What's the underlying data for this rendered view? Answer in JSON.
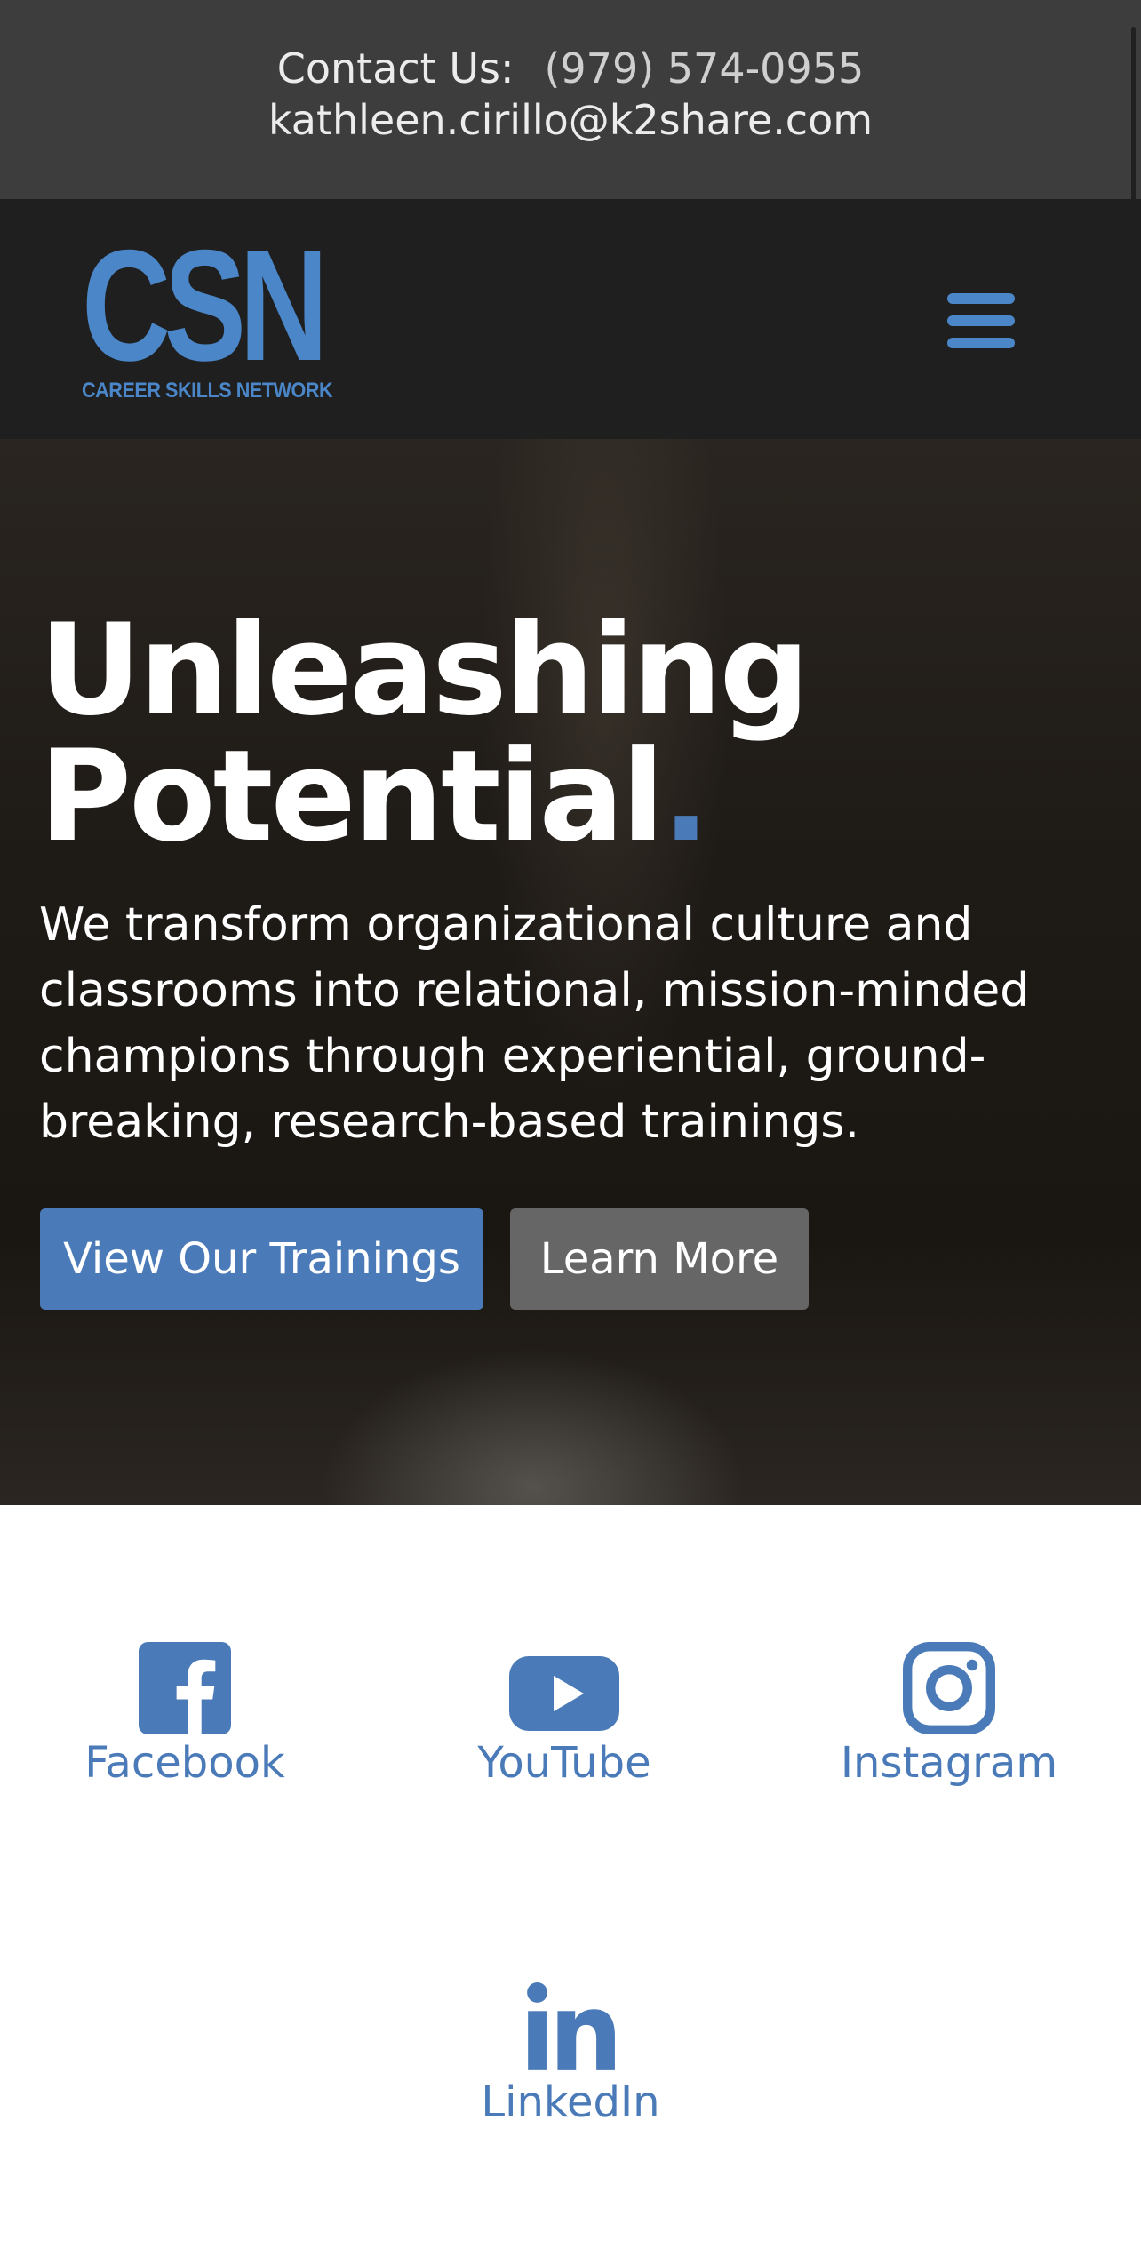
{
  "contact": {
    "label": "Contact Us:",
    "phone": "(979) 574-0955",
    "email": "kathleen.cirillo@k2share.com"
  },
  "logo": {
    "letters": "CSN",
    "subtitle": "CAREER SKILLS NETWORK"
  },
  "nav": {
    "menu_icon": "hamburger-menu-icon"
  },
  "hero": {
    "title_line1": "Unleashing",
    "title_line2": "Potential",
    "title_dot": ".",
    "description": "We transform organizational culture and classrooms into relational, mission-minded champions through experiential, ground-breaking, research-based trainings.",
    "primary_button": "View Our Trainings",
    "secondary_button": "Learn More"
  },
  "social": {
    "items": [
      {
        "label": "Facebook",
        "icon": "facebook-icon"
      },
      {
        "label": "YouTube",
        "icon": "youtube-icon"
      },
      {
        "label": "Instagram",
        "icon": "instagram-icon"
      },
      {
        "label": "LinkedIn",
        "icon": "linkedin-icon"
      }
    ]
  },
  "colors": {
    "accent": "#4a7ab8",
    "logo": "#4a86c8",
    "contact_bg": "#3d3d3d",
    "nav_bg": "#1f1f1f",
    "secondary_button": "#666666"
  }
}
